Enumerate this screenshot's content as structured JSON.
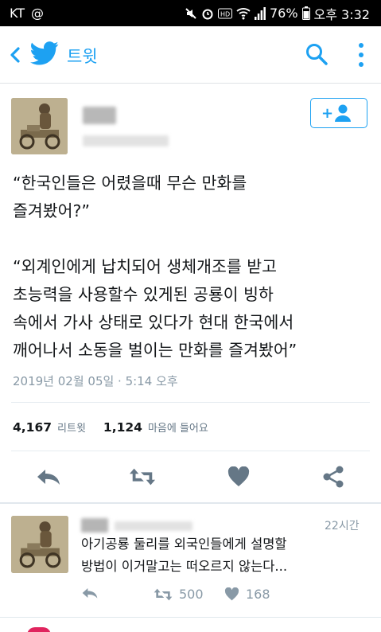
{
  "status_bar": {
    "carrier": "KT",
    "at_symbol": "@",
    "battery": "76%",
    "time": "오후 3:32",
    "icons": [
      "mute-icon",
      "alarm-icon",
      "hd-icon",
      "wifi-icon",
      "signal-icon",
      "battery-icon"
    ]
  },
  "app_bar": {
    "title": "트윗",
    "icons": [
      "back-arrow-icon",
      "twitter-bird-icon",
      "search-icon",
      "more-vert-icon"
    ],
    "accent": "#1da1f2"
  },
  "tweet": {
    "quote_1": "“한국인들은 어렸을때 무슨 만화를\n즐겨봤어?”",
    "quote_2": "“외계인에게 납치되어 생체개조를 받고\n초능력을 사용할수 있게된 공룡이 빙하\n속에서 가사 상태로 있다가 현대 한국에서\n깨어나서 소동을 벌이는 만화를 즐겨봤어”",
    "timestamp": "2019년 02월 05일 · 5:14 오후",
    "retweets": "4,167",
    "retweets_label": "리트윗",
    "likes": "1,124",
    "likes_label": "마음에 들어요",
    "actions": [
      "reply-icon",
      "retweet-icon",
      "heart-icon",
      "share-icon"
    ]
  },
  "reply": {
    "time": "22시간",
    "text": "아기공룡 둘리를 외국인들에게 설명할\n방법이 이거말고는 떠오르지 않는다...",
    "retweets": "500",
    "likes": "168"
  },
  "colors": {
    "text": "#14171a",
    "muted": "#8899a6",
    "divider": "#e6ecf0",
    "action_icon": "#657786"
  }
}
